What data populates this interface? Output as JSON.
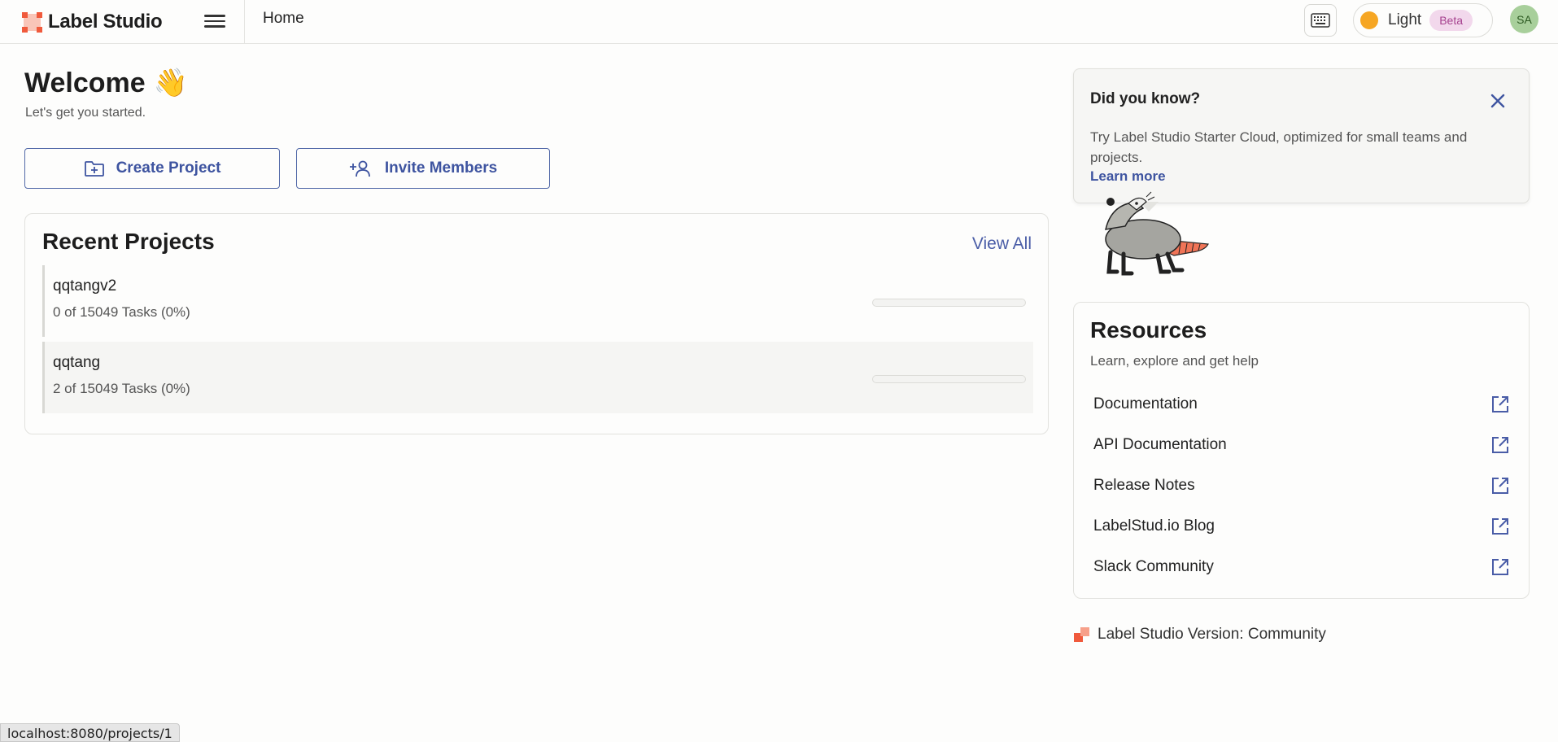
{
  "app": {
    "name": "Label Studio",
    "brand_color": "#f05a3c",
    "accent_color": "#4a5da7"
  },
  "header": {
    "breadcrumb": "Home",
    "theme_label": "Light",
    "theme_badge": "Beta",
    "avatar_initials": "SA",
    "icons": [
      "hamburger-icon",
      "keyboard-icon",
      "sun-icon"
    ]
  },
  "welcome": {
    "title": "Welcome",
    "emoji": "👋",
    "subtitle": "Let's get you started."
  },
  "actions": {
    "create_label": "Create Project",
    "invite_label": "Invite Members"
  },
  "recent_projects": {
    "title": "Recent Projects",
    "view_all": "View All",
    "items": [
      {
        "name": "qqtangv2",
        "tasks": "0 of 15049 Tasks (0%)",
        "progress": 0
      },
      {
        "name": "qqtang",
        "tasks": "2 of 15049 Tasks (0%)",
        "progress": 0
      }
    ]
  },
  "tip": {
    "title": "Did you know?",
    "body": "Try Label Studio Starter Cloud, optimized for small teams and projects.",
    "link": "Learn more"
  },
  "resources": {
    "title": "Resources",
    "subtitle": "Learn, explore and get help",
    "items": [
      {
        "label": "Documentation"
      },
      {
        "label": "API Documentation"
      },
      {
        "label": "Release Notes"
      },
      {
        "label": "LabelStud.io Blog"
      },
      {
        "label": "Slack Community"
      }
    ]
  },
  "version": {
    "text": "Label Studio Version: Community"
  },
  "status_bar": {
    "url": "localhost:8080/projects/1"
  }
}
